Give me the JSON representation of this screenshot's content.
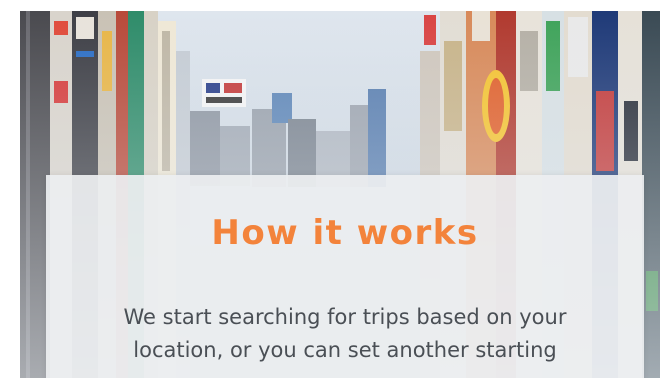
{
  "section": {
    "title": "How it works",
    "body": "We start searching for trips based on your location, or you can set another starting"
  },
  "colors": {
    "title_accent": "#f3833b",
    "body_text": "#4a4f55",
    "card_background": "#eceef0"
  }
}
